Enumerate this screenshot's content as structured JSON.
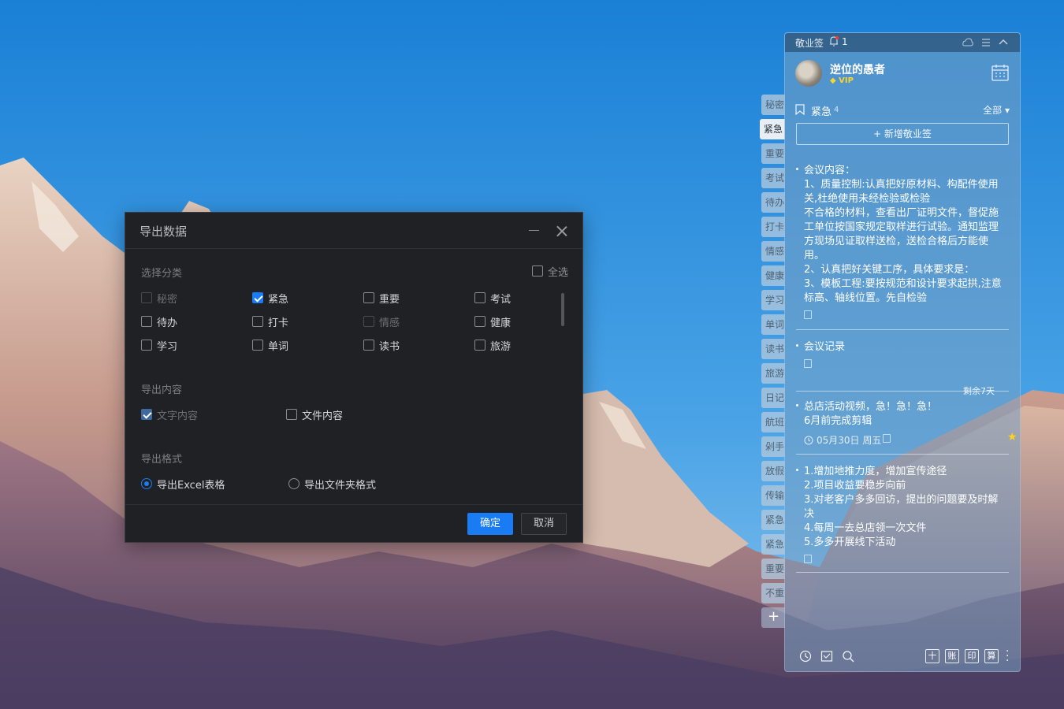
{
  "dialog": {
    "title": "导出数据",
    "category_section": "选择分类",
    "select_all": "全选",
    "categories": [
      {
        "label": "秘密",
        "checked": false,
        "disabled": true
      },
      {
        "label": "紧急",
        "checked": true,
        "disabled": false
      },
      {
        "label": "重要",
        "checked": false,
        "disabled": false
      },
      {
        "label": "考试",
        "checked": false,
        "disabled": false
      },
      {
        "label": "待办",
        "checked": false,
        "disabled": false
      },
      {
        "label": "打卡",
        "checked": false,
        "disabled": false
      },
      {
        "label": "情感",
        "checked": false,
        "disabled": true
      },
      {
        "label": "健康",
        "checked": false,
        "disabled": false
      },
      {
        "label": "学习",
        "checked": false,
        "disabled": false
      },
      {
        "label": "单词",
        "checked": false,
        "disabled": false
      },
      {
        "label": "读书",
        "checked": false,
        "disabled": false
      },
      {
        "label": "旅游",
        "checked": false,
        "disabled": false
      }
    ],
    "content_section": "导出内容",
    "content_options": [
      {
        "label": "文字内容",
        "checked": true,
        "disabled": true
      },
      {
        "label": "文件内容",
        "checked": false,
        "disabled": false
      }
    ],
    "format_section": "导出格式",
    "format_options": [
      {
        "label": "导出Excel表格",
        "selected": true
      },
      {
        "label": "导出文件夹格式",
        "selected": false
      }
    ],
    "ok_label": "确定",
    "cancel_label": "取消",
    "accent_color": "#1a7cf4"
  },
  "side_tabs": [
    "秘密",
    "紧急",
    "重要",
    "考试",
    "待办",
    "打卡",
    "情感",
    "健康",
    "学习",
    "单词",
    "读书",
    "旅游",
    "日记",
    "航班",
    "剁手",
    "放假",
    "传输",
    "紧急",
    "紧急",
    "重要",
    "不重"
  ],
  "side_tab_active": "紧急",
  "note_panel": {
    "app_name": "敬业签",
    "notification_count": "1",
    "username": "逆位的愚者",
    "vip_label": "VIP",
    "category_name": "紧急",
    "category_count": "4",
    "filter_label": "全部 ▾",
    "add_note_label": "+ 新增敬业签",
    "notes": [
      {
        "lines": [
          "会议内容：",
          "1、质量控制:认真把好原材料、构配件使用",
          "关,杜绝使用未经检验或检验",
          "不合格的材料，查看出厂证明文件，督促施",
          "工单位按国家规定取样进行试验。通知监理",
          "方现场见证取样送检，送检合格后方能使",
          "用。",
          "2、认真把好关键工序，具体要求是：",
          "3、模板工程:要按规范和设计要求起拱,注意",
          "标高、轴线位置。先自检验"
        ]
      },
      {
        "lines": [
          "会议记录"
        ]
      },
      {
        "remaining": "剩余7天",
        "lines": [
          "总店活动视频，急！急！急！",
          "6月前完成剪辑"
        ],
        "date": "05月30日 周五"
      },
      {
        "lines": [
          "1.增加地推力度，增加宣传途径",
          "2.项目收益要稳步向前",
          "3.对老客户多多回访，提出的问题要及时解",
          "决",
          "4.每周一去总店领一次文件",
          "5.多多开展线下活动"
        ]
      }
    ],
    "bottom_boxes": [
      "十",
      "账",
      "印",
      "算"
    ]
  }
}
